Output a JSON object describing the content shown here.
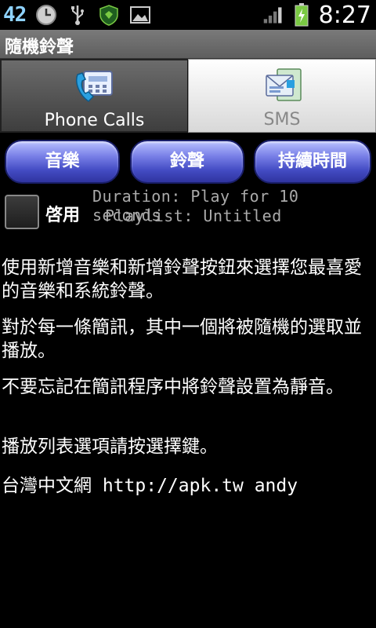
{
  "status_bar": {
    "notification_number": "42",
    "icons": [
      "clock-icon",
      "usb-icon",
      "shield-app-icon",
      "picture-icon"
    ],
    "right_icons": [
      "signal-icon",
      "battery-charging-icon"
    ],
    "time": "8:27"
  },
  "app": {
    "title": "隨機鈴聲"
  },
  "tabs": [
    {
      "label": "Phone Calls",
      "icon": "phone-icon",
      "selected": true
    },
    {
      "label": "SMS",
      "icon": "sms-icon",
      "selected": false
    }
  ],
  "buttons": {
    "music": "音樂",
    "ringtone": "鈴聲",
    "duration": "持續時間"
  },
  "enable": {
    "label": "啓用",
    "checked": false
  },
  "info": {
    "duration": "Duration: Play for 10 seconds",
    "playlist": "Playlist: Untitled"
  },
  "paragraphs": [
    "使用新增音樂和新增鈴聲按鈕來選擇您最喜愛的音樂和系統鈴聲。",
    "對於每一條簡訊，其中一個將被隨機的選取並播放。",
    "不要忘記在簡訊程序中將鈴聲設置為靜音。",
    "播放列表選項請按選擇鍵。",
    "台灣中文網 http://apk.tw andy"
  ],
  "colors": {
    "button_accent": "#444cc4",
    "notification_number": "#8fd3ff",
    "battery": "#7ac943"
  }
}
